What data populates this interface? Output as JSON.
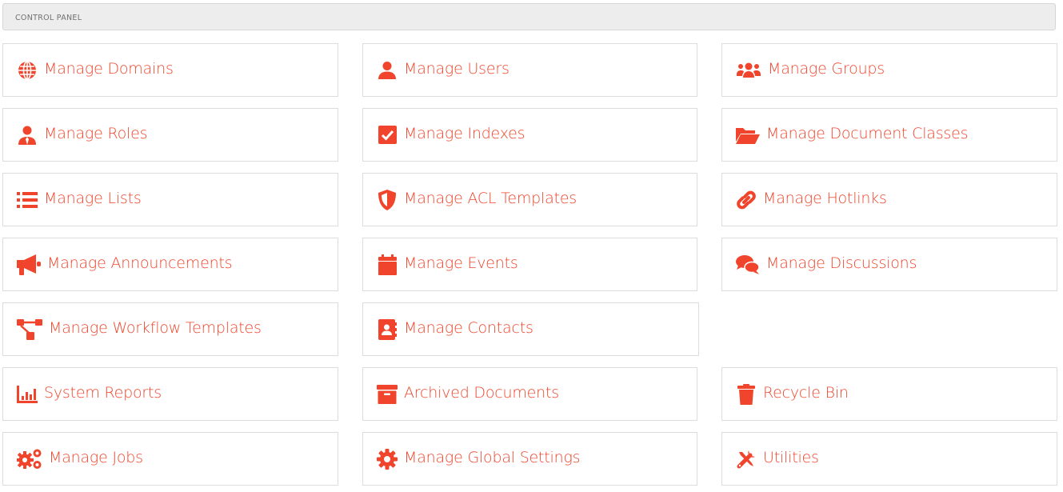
{
  "header": {
    "title": "CONTROL PANEL"
  },
  "theme": {
    "accent": "#f0452c",
    "border": "#dcdcdc",
    "header_bg": "#ededed"
  },
  "items": [
    {
      "label": "Manage Domains",
      "icon": "globe-icon"
    },
    {
      "label": "Manage Users",
      "icon": "user-icon"
    },
    {
      "label": "Manage Groups",
      "icon": "users-group-icon"
    },
    {
      "label": "Manage Roles",
      "icon": "user-tie-icon"
    },
    {
      "label": "Manage Indexes",
      "icon": "check-square-icon"
    },
    {
      "label": "Manage Document Classes",
      "icon": "folder-open-icon"
    },
    {
      "label": "Manage Lists",
      "icon": "list-icon"
    },
    {
      "label": "Manage ACL Templates",
      "icon": "shield-icon"
    },
    {
      "label": "Manage Hotlinks",
      "icon": "link-icon"
    },
    {
      "label": "Manage Announcements",
      "icon": "bullhorn-icon"
    },
    {
      "label": "Manage Events",
      "icon": "calendar-icon"
    },
    {
      "label": "Manage Discussions",
      "icon": "comments-icon"
    },
    {
      "label": "Manage Workflow Templates",
      "icon": "workflow-icon"
    },
    {
      "label": "Manage Contacts",
      "icon": "address-book-icon"
    },
    {
      "label": "System Reports",
      "icon": "chart-bar-icon"
    },
    {
      "label": "Archived Documents",
      "icon": "archive-icon"
    },
    {
      "label": "Recycle Bin",
      "icon": "trash-icon"
    },
    {
      "label": "Manage Jobs",
      "icon": "cogs-icon"
    },
    {
      "label": "Manage Global Settings",
      "icon": "cog-icon"
    },
    {
      "label": "Utilities",
      "icon": "tools-icon"
    }
  ]
}
